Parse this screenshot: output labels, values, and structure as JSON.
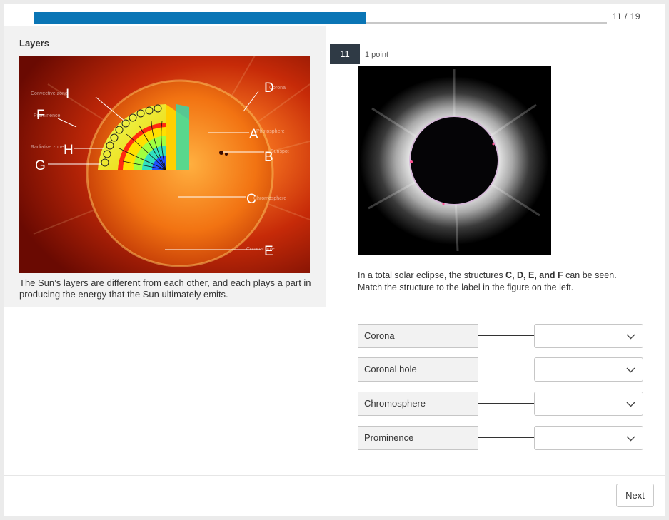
{
  "progress": {
    "count": "11 / 19",
    "fraction": 0.58
  },
  "left_panel": {
    "title": "Layers",
    "caption": "The Sun’s layers are different from each other, and each plays a part in producing the energy that the Sun ultimately emits.",
    "figure": {
      "labels": {
        "A": "A",
        "B": "B",
        "C": "C",
        "D": "D",
        "E": "E",
        "F": "F",
        "G": "G",
        "H": "H",
        "I": "I"
      }
    }
  },
  "question": {
    "number": "11",
    "points": "1 point",
    "text_before": "In a total solar eclipse, the structures ",
    "text_bold": "C, D, E, and F",
    "text_after": " can be seen. Match the structure to the label in the figure on the left.",
    "matches": [
      {
        "label": "Corona",
        "value": ""
      },
      {
        "label": "Coronal hole",
        "value": ""
      },
      {
        "label": "Chromosphere",
        "value": ""
      },
      {
        "label": "Prominence",
        "value": ""
      }
    ]
  },
  "footer": {
    "next_label": "Next"
  },
  "colors": {
    "accent": "#0a75b5",
    "badge": "#2f3a45"
  }
}
